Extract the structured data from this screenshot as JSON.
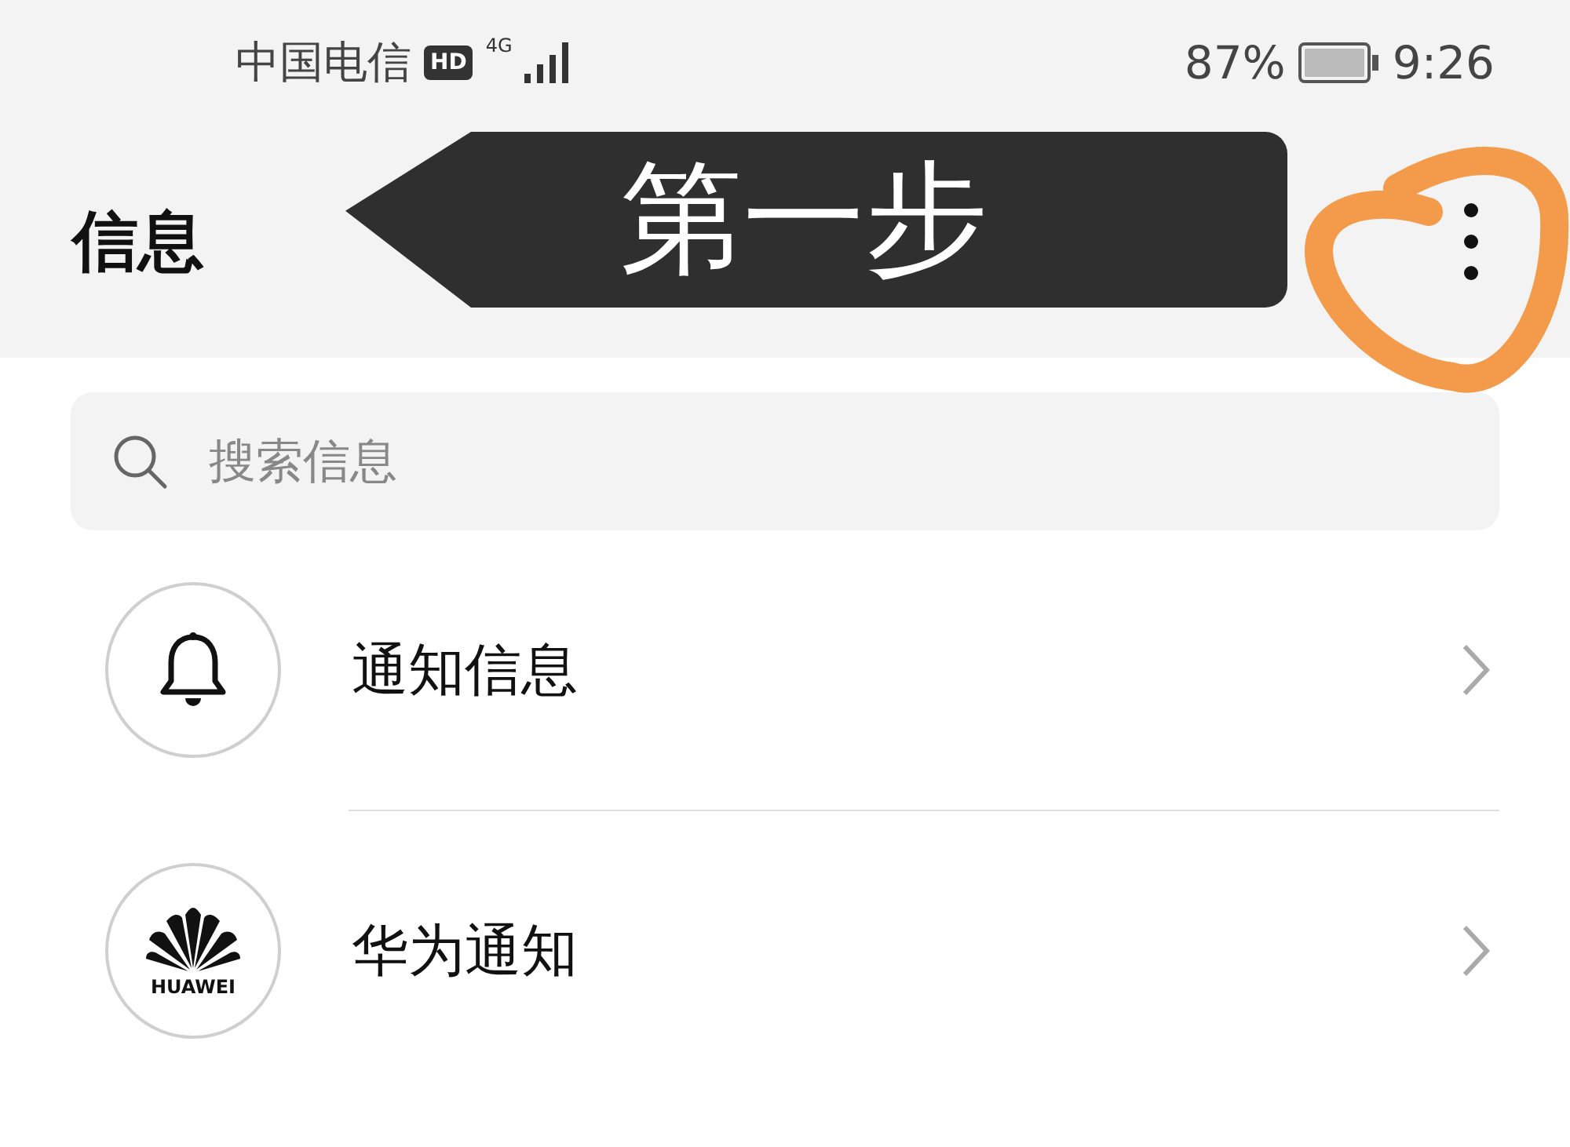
{
  "status_bar": {
    "carrier": "中国电信",
    "hd": "HD",
    "network": "4G",
    "battery": "87%",
    "time": "9:26"
  },
  "annotation": {
    "label": "第一步"
  },
  "header": {
    "title": "信息"
  },
  "search": {
    "placeholder": "搜索信息"
  },
  "items": [
    {
      "kind": "bell",
      "label": "通知信息"
    },
    {
      "kind": "brand",
      "label": "华为通知",
      "logo_text": "HUAWEI"
    }
  ]
}
